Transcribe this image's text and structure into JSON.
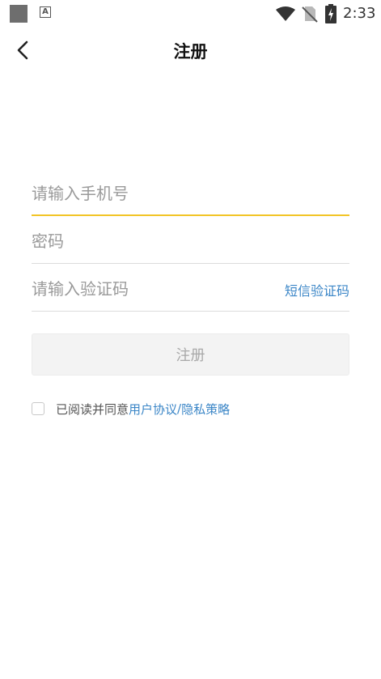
{
  "status_bar": {
    "time": "2:33",
    "icons": [
      "square-icon",
      "a-icon",
      "wifi-icon",
      "no-sim-icon",
      "battery-icon"
    ],
    "a_icon_letter": "A"
  },
  "header": {
    "title": "注册",
    "back_icon": "chevron-left-icon"
  },
  "form": {
    "phone": {
      "placeholder": "请输入手机号",
      "value": ""
    },
    "password": {
      "placeholder": "密码",
      "value": ""
    },
    "code": {
      "placeholder": "请输入验证码",
      "value": ""
    },
    "sms_link": "短信验证码",
    "submit_label": "注册"
  },
  "agreement": {
    "checked": false,
    "prefix": "已阅读并同意",
    "user_agreement": "用户协议",
    "separator": "/",
    "privacy_policy": "隐私策略"
  },
  "colors": {
    "accent_underline": "#f2c426",
    "link": "#3b86c7",
    "disabled_button_bg": "#f3f3f3",
    "disabled_button_text": "#a8a8a8"
  }
}
